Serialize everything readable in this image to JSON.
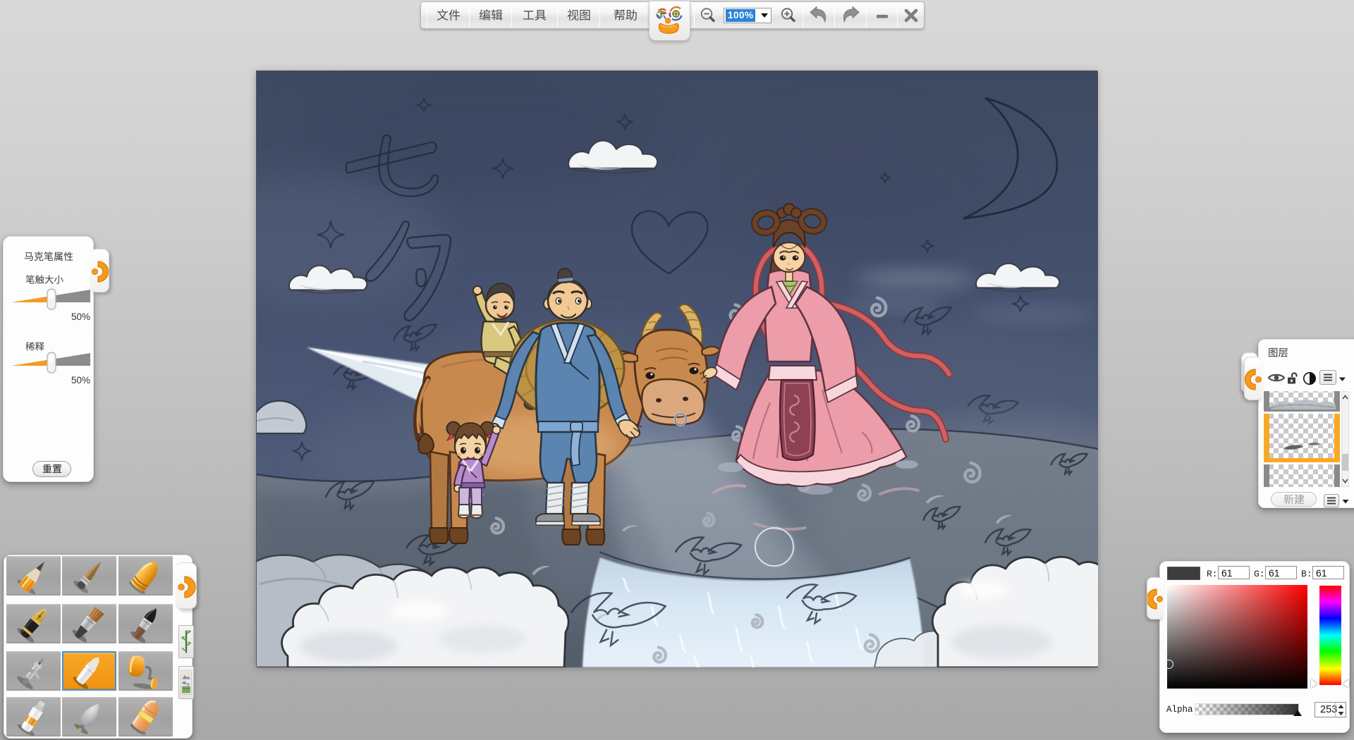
{
  "menubar": {
    "items": [
      {
        "label": "文件"
      },
      {
        "label": "编辑"
      },
      {
        "label": "工具"
      },
      {
        "label": "视图"
      },
      {
        "label": "帮助"
      }
    ]
  },
  "toolbar": {
    "zoom_value": "100%",
    "icons": [
      "zoom-out",
      "zoom-in",
      "undo",
      "redo",
      "minimize",
      "close"
    ]
  },
  "marker_panel": {
    "title": "马克笔属性",
    "sliders": [
      {
        "label": "笔触大小",
        "value": "50%",
        "percent": 50
      },
      {
        "label": "稀释",
        "value": "50%",
        "percent": 50
      }
    ],
    "reset_label": "重置"
  },
  "toolbox": {
    "tools": [
      {
        "name": "pencil"
      },
      {
        "name": "sketch-stick"
      },
      {
        "name": "crayon"
      },
      {
        "name": "fountain-pen"
      },
      {
        "name": "flat-brush"
      },
      {
        "name": "ink-brush"
      },
      {
        "name": "airbrush"
      },
      {
        "name": "marker",
        "selected": true
      },
      {
        "name": "paint-roller"
      },
      {
        "name": "paint-tube"
      },
      {
        "name": "smudge"
      },
      {
        "name": "eraser"
      }
    ],
    "extras": [
      {
        "name": "bamboo-stamp"
      },
      {
        "name": "picture-stamp"
      }
    ]
  },
  "layers_panel": {
    "title": "图层",
    "new_label": "新建",
    "buttons": [
      "visibility",
      "lock",
      "opacity",
      "layer-menu"
    ],
    "layers": [
      {
        "name": "layer-top",
        "content": "clouds"
      },
      {
        "name": "layer-selected",
        "content": "sketch-strokes",
        "selected": true
      },
      {
        "name": "layer-bottom",
        "content": "empty"
      }
    ]
  },
  "color_panel": {
    "r_label": "R:",
    "g_label": "G:",
    "b_label": "B:",
    "r": "61",
    "g": "61",
    "b": "61",
    "alpha_label": "Alpha",
    "alpha": "253",
    "swatch": "#3d3d3d"
  },
  "canvas": {
    "sketch_characters": "七夕"
  },
  "colors": {
    "accent_orange": "#f59b1c",
    "selection_blue": "#4391d6",
    "highlight_blue": "#2a84d8",
    "swatch_gray": "#3d3d3d"
  }
}
